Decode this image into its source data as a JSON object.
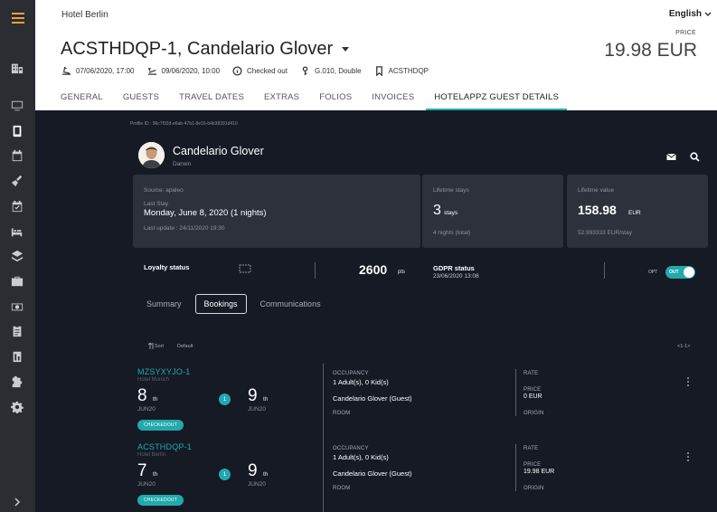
{
  "header": {
    "hotel_name": "Hotel Berlin",
    "language": "English",
    "title": "ACSTHDQP-1, Candelario Glover",
    "price_label": "PRICE",
    "price_value": "19.98 EUR",
    "meta": {
      "arrival": "07/06/2020, 17:00",
      "departure": "09/06/2020, 10:00",
      "status": "Checked out",
      "unit": "G.010, Double",
      "booking_id": "ACSTHDQP"
    },
    "tabs": [
      "GENERAL",
      "GUESTS",
      "TRAVEL DATES",
      "EXTRAS",
      "FOLIOS",
      "INVOICES",
      "HOTELAPPZ GUEST DETAILS"
    ],
    "active_tab": "HOTELAPPZ GUEST DETAILS"
  },
  "profile": {
    "profile_id": "Profile ID : 96c7f32d-e6ab-47b1-8e16-b4b38391d410",
    "name": "Candelario Glover",
    "city": "Darwin"
  },
  "cards": {
    "source": "Source: apaleo",
    "last_stay_label": "Last Stay",
    "last_stay_value": "Monday, June 8, 2020 (1 nights)",
    "last_update": "Last update : 24/11/2020 19:30",
    "lifetime_stays_label": "Lifetime stays",
    "lifetime_stays_value": "3",
    "lifetime_stays_unit": "stays",
    "lifetime_nights": "4 nights (total)",
    "lifetime_value_label": "Lifetime value",
    "lifetime_value_value": "158.98",
    "lifetime_value_unit": "EUR",
    "per_stay": "52.993333 EUR/stay"
  },
  "loyalty": {
    "label": "Loyalty status",
    "points": "2600",
    "points_unit": "pts",
    "gdpr_label": "GDPR status",
    "gdpr_date": "23/06/2020 13:08",
    "opt_label": "OPT",
    "toggle_label": "OUT"
  },
  "subtabs": [
    "Summary",
    "Bookings",
    "Communications"
  ],
  "active_subtab": "Bookings",
  "list": {
    "sort_label": "Sort",
    "sort_value": "Default",
    "pager": "<1-1>"
  },
  "bookings": [
    {
      "code": "MZSYXYJO-1",
      "hotel": "Hotel Munich",
      "arrive_day": "8",
      "arrive_suffix": "th",
      "arrive_month": "JUN20",
      "nights": "1",
      "depart_day": "9",
      "depart_suffix": "th",
      "depart_month": "JUN20",
      "status": "CHECKEDOUT",
      "occupancy_label": "OCCUPANCY",
      "occupancy": "1 Adult(s), 0 Kid(s)",
      "guest": "Candelario Glover (Guest)",
      "room_label": "ROOM",
      "rate_label": "RATE",
      "price_label": "PRICE",
      "price": "0 EUR",
      "origin_label": "ORIGIN"
    },
    {
      "code": "ACSTHDQP-1",
      "hotel": "Hotel Berlin",
      "arrive_day": "7",
      "arrive_suffix": "th",
      "arrive_month": "JUN20",
      "nights": "1",
      "depart_day": "9",
      "depart_suffix": "th",
      "depart_month": "JUN20",
      "status": "CHECKEDOUT",
      "occupancy_label": "OCCUPANCY",
      "occupancy": "1 Adult(s), 0 Kid(s)",
      "guest": "Candelario Glover (Guest)",
      "room_label": "ROOM",
      "rate_label": "RATE",
      "price_label": "PRICE",
      "price": "19.98 EUR",
      "origin_label": "ORIGIN"
    }
  ],
  "colors": {
    "accent": "#22a9ad",
    "rail": "#2a2d31",
    "dark_bg": "#151a24",
    "card_bg": "#2c313b",
    "menu": "#e8a23a"
  }
}
